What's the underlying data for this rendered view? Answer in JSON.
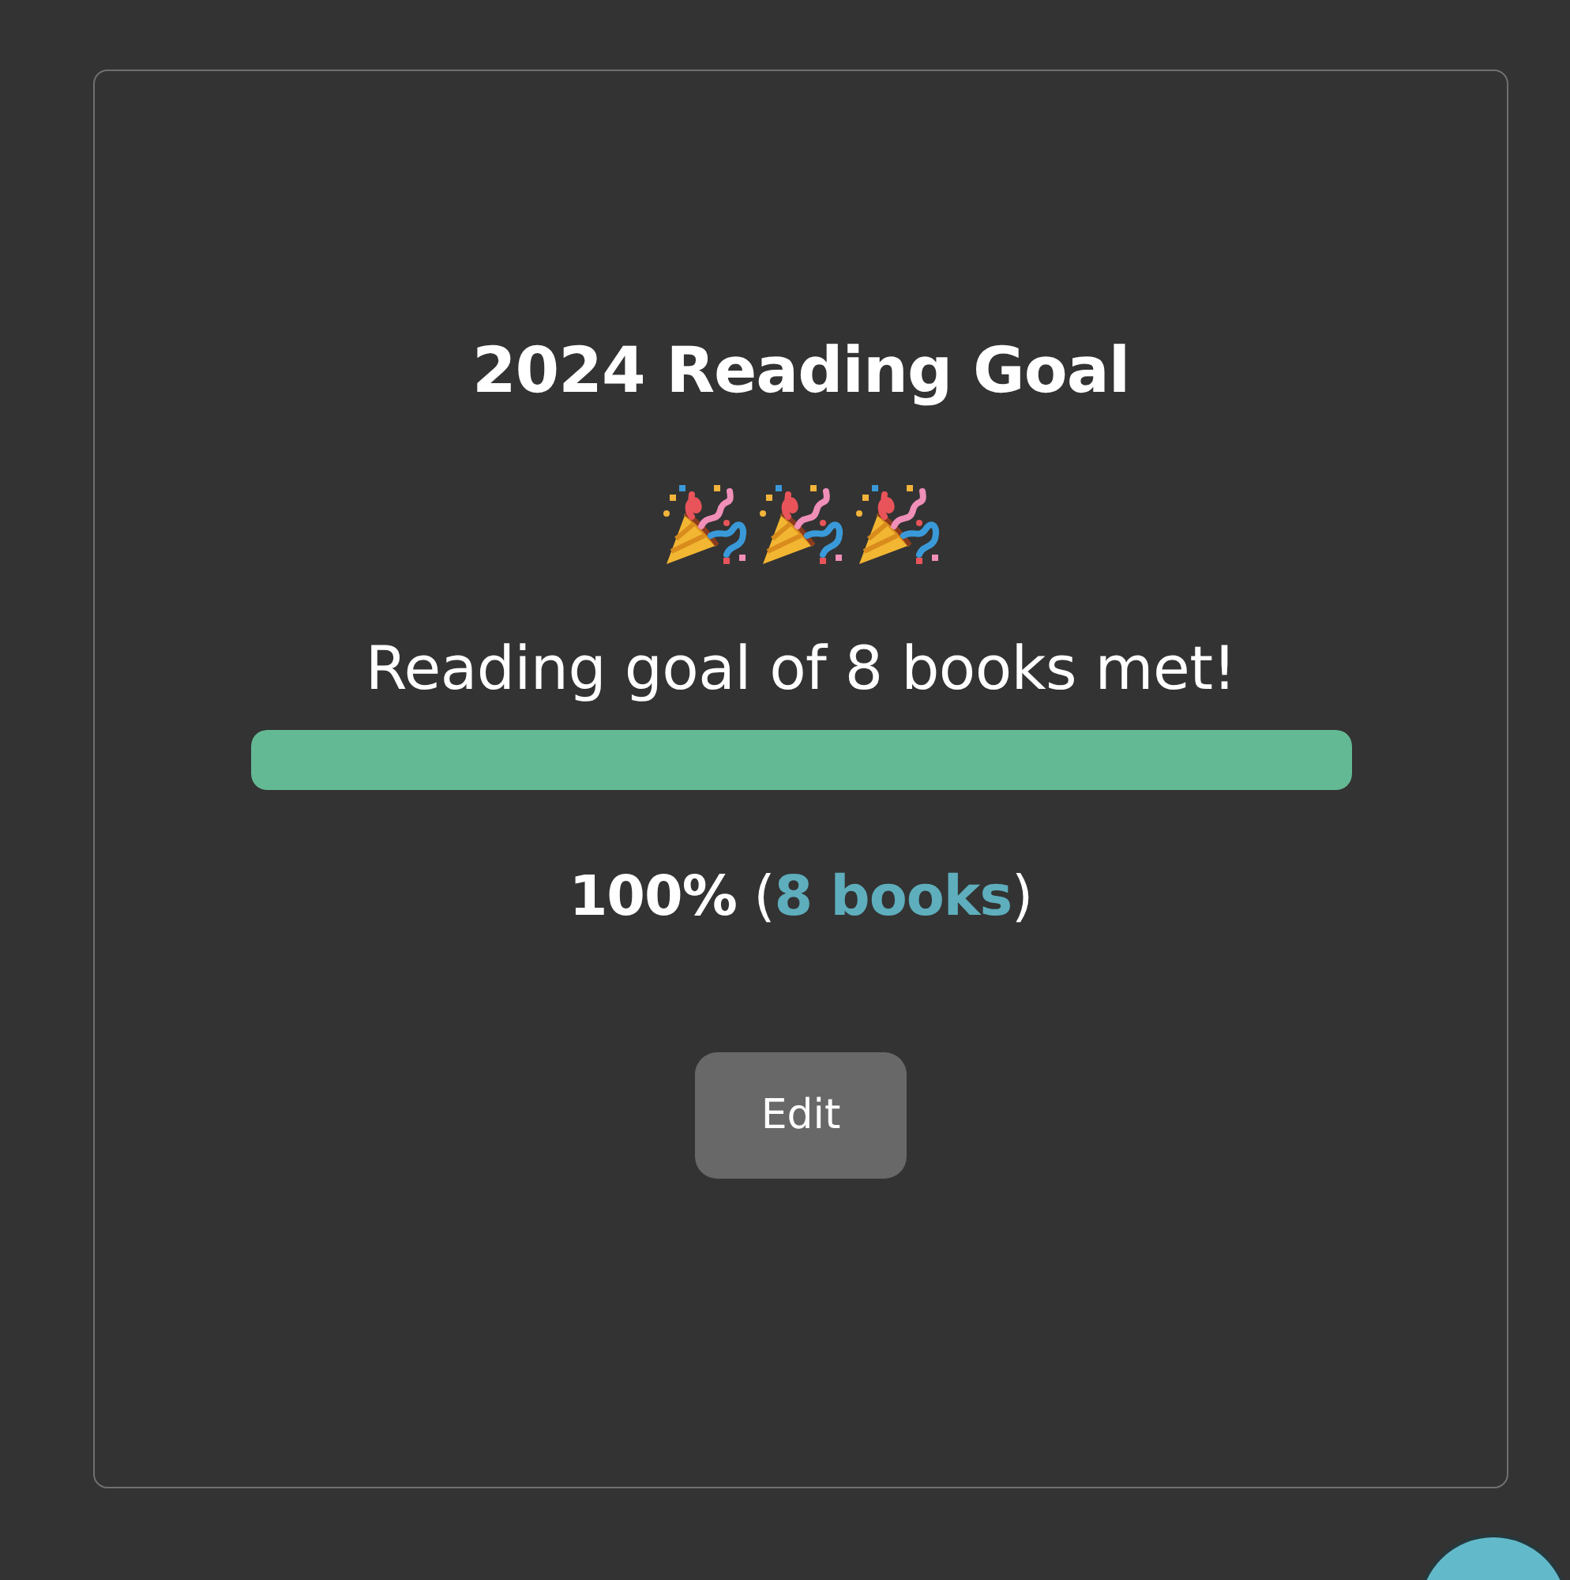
{
  "card": {
    "title": "2024 Reading Goal",
    "message": "Reading goal of 8 books met!",
    "progress": {
      "level": 1
    },
    "summary": [
      {
        "kind": "strong",
        "text": "100%"
      },
      {
        "kind": "plain",
        "text": " ("
      },
      {
        "kind": "link",
        "text": "8 books"
      },
      {
        "kind": "plain",
        "text": ")"
      }
    ],
    "edit_button": "Edit"
  }
}
